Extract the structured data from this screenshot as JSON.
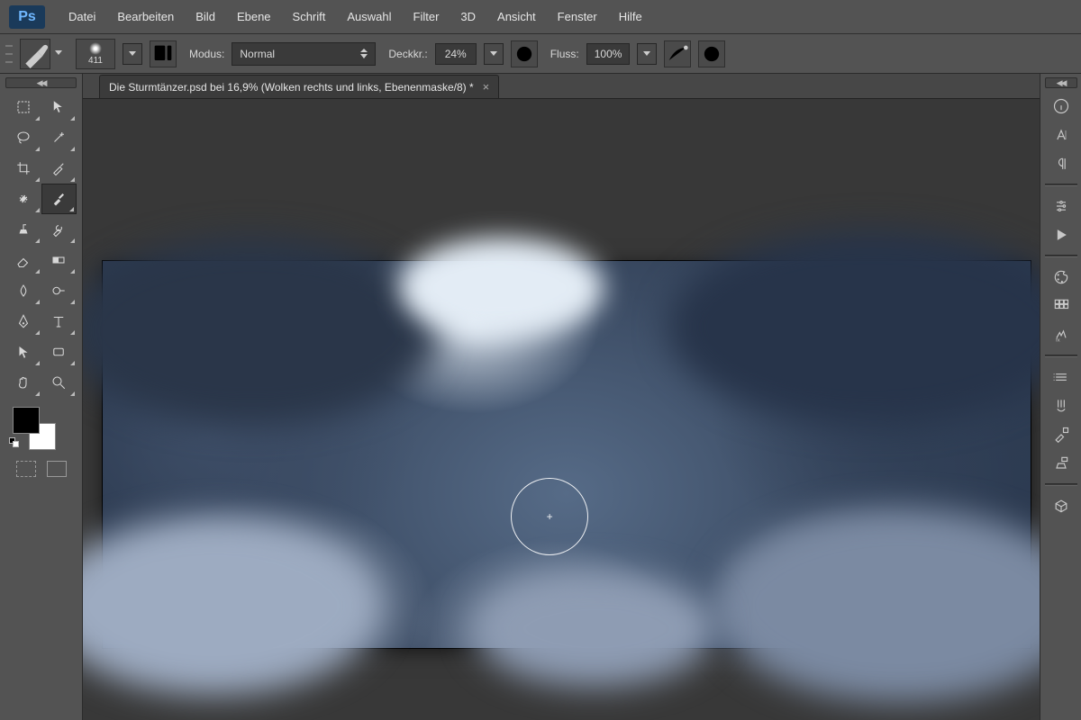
{
  "app": {
    "logo_text": "Ps"
  },
  "menubar": {
    "items": [
      "Datei",
      "Bearbeiten",
      "Bild",
      "Ebene",
      "Schrift",
      "Auswahl",
      "Filter",
      "3D",
      "Ansicht",
      "Fenster",
      "Hilfe"
    ]
  },
  "optionsbar": {
    "brush_size": "411",
    "modus_label": "Modus:",
    "modus_value": "Normal",
    "opacity_label": "Deckkr.:",
    "opacity_value": "24%",
    "flow_label": "Fluss:",
    "flow_value": "100%"
  },
  "document": {
    "tab_title": "Die Sturmtänzer.psd bei 16,9% (Wolken rechts und links, Ebenenmaske/8) *"
  },
  "tools": {
    "list": [
      "marquee",
      "move",
      "lasso",
      "magic-wand",
      "crop",
      "eyedropper",
      "spot-heal",
      "brush",
      "clone-stamp",
      "history-brush",
      "eraser",
      "gradient",
      "blur",
      "dodge",
      "pen",
      "type",
      "path-select",
      "shape",
      "hand",
      "zoom"
    ],
    "active": "brush"
  },
  "swatches": {
    "foreground": "#000000",
    "background": "#ffffff"
  },
  "right_panels": {
    "groups": [
      [
        "info",
        "character",
        "paragraph"
      ],
      [
        "gear-preset",
        "play-actions"
      ],
      [
        "palette",
        "swatches-grid",
        "fx"
      ],
      [
        "ruler",
        "brushes",
        "brush-preset",
        "clone-src"
      ],
      [
        "3d"
      ]
    ]
  }
}
